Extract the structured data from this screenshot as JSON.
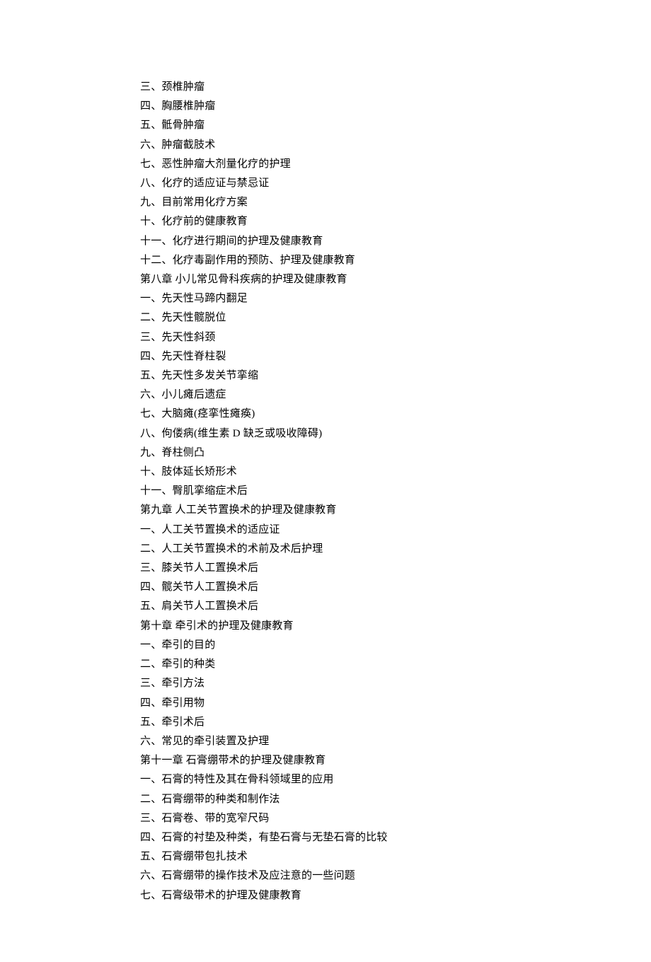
{
  "lines": [
    "三、颈椎肿瘤",
    "四、胸腰椎肿瘤",
    "五、骶骨肿瘤",
    "六、肿瘤截肢术",
    "七、恶性肿瘤大剂量化疗的护理",
    "八、化疗的适应证与禁忌证",
    "九、目前常用化疗方案",
    "十、化疗前的健康教育",
    "十一、化疗进行期间的护理及健康教育",
    "十二、化疗毒副作用的预防、护理及健康教育",
    "第八章 小儿常见骨科疾病的护理及健康教育",
    "一、先天性马蹄内翻足",
    "二、先天性髋脱位",
    "三、先天性斜颈",
    "四、先天性脊柱裂",
    "五、先天性多发关节挛缩",
    "六、小儿瘫后遗症",
    "七、大脑瘫(痉挛性瘫痪)",
    "八、佝偻病(维生素 D 缺乏或吸收障碍)",
    "九、脊柱侧凸",
    "十、肢体延长矫形术",
    "十一、臀肌挛缩症术后",
    "第九章 人工关节置换术的护理及健康教育",
    "一、人工关节置换术的适应证",
    "二、人工关节置换术的术前及术后护理",
    "三、膝关节人工置换术后",
    "四、髋关节人工置换术后",
    "五、肩关节人工置换术后",
    "第十章 牵引术的护理及健康教育",
    "一、牵引的目的",
    "二、牵引的种类",
    "三、牵引方法",
    "四、牵引用物",
    "五、牵引术后",
    "六、常见的牵引装置及护理",
    "第十一章 石膏绷带术的护理及健康教育",
    "一、石膏的特性及其在骨科领域里的应用",
    "二、石膏绷带的种类和制作法",
    "三、石膏卷、带的宽窄尺码",
    "四、石膏的衬垫及种类，有垫石膏与无垫石膏的比较",
    "五、石膏绷带包扎技术",
    "六、石膏绷带的操作技术及应注意的一些问题",
    "七、石膏级带术的护理及健康教育"
  ]
}
